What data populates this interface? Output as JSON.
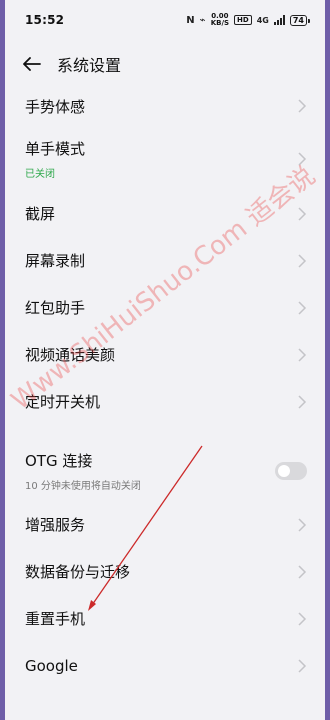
{
  "status_bar": {
    "time": "15:52",
    "net_speed_top": "0.00",
    "net_speed_bottom": "KB/S",
    "hd": "HD",
    "net_type": "4G",
    "battery": "74"
  },
  "header": {
    "title": "系统设置",
    "back_icon": "arrow-left-icon"
  },
  "settings": [
    {
      "label": "手势体感"
    },
    {
      "label": "单手模式",
      "sub": "已关闭",
      "sub_color": "#2ea84b"
    },
    {
      "label": "截屏"
    },
    {
      "label": "屏幕录制"
    },
    {
      "label": "红包助手"
    },
    {
      "label": "视频通话美颜"
    },
    {
      "label": "定时开关机"
    },
    {
      "label": "OTG 连接",
      "sub": "10 分钟未使用将自动关闭",
      "toggle": "off"
    },
    {
      "label": "增强服务"
    },
    {
      "label": "数据备份与迁移"
    },
    {
      "label": "重置手机"
    },
    {
      "label": "Google"
    }
  ],
  "watermark": "Www.ShiHuiShuo.Com 适会说",
  "colors": {
    "background": "#f2f2f5",
    "accent_green": "#2ea84b",
    "annotation_arrow": "#cc2a2a"
  }
}
